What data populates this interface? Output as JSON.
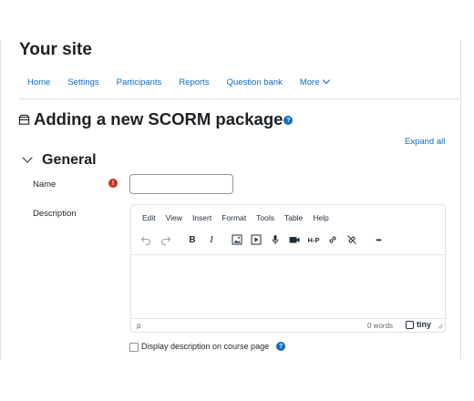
{
  "site": {
    "title": "Your site"
  },
  "nav": {
    "items": [
      {
        "label": "Home"
      },
      {
        "label": "Settings"
      },
      {
        "label": "Participants"
      },
      {
        "label": "Reports"
      },
      {
        "label": "Question bank"
      },
      {
        "label": "More"
      }
    ]
  },
  "page": {
    "heading": "Adding a new SCORM package",
    "help_glyph": "?",
    "expand_all": "Expand all"
  },
  "section": {
    "title": "General"
  },
  "form": {
    "name_label": "Name",
    "required_glyph": "!",
    "name_value": "",
    "description_label": "Description",
    "display_description_label": "Display description on course page"
  },
  "editor": {
    "menu": [
      "Edit",
      "View",
      "Insert",
      "Format",
      "Tools",
      "Table",
      "Help"
    ],
    "toolbar_icons": [
      "undo-icon",
      "redo-icon",
      "bold-icon",
      "italic-icon",
      "image-icon",
      "media-icon",
      "microphone-icon",
      "video-camera-icon",
      "h5p-icon",
      "link-icon",
      "unlink-icon",
      "more-icon"
    ],
    "bold_glyph": "B",
    "italic_glyph": "I",
    "h5p_glyph": "H-P",
    "more_glyph": "•••",
    "status_path": "p",
    "word_count": "0 words",
    "brand": "tiny"
  },
  "colors": {
    "link": "#0f6cbf",
    "required": "#ca3120",
    "text": "#1d2125"
  }
}
